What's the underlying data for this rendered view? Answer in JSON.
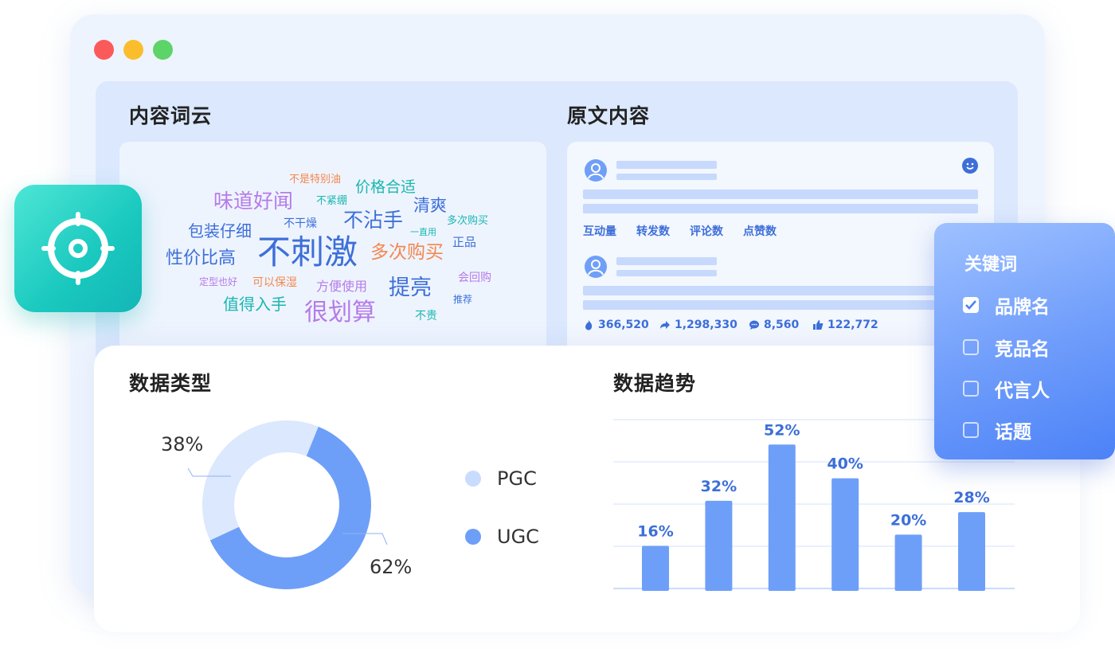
{
  "window": {
    "traffic_lights": [
      "red",
      "yellow",
      "green"
    ]
  },
  "wordcloud": {
    "title": "内容词云",
    "words": [
      {
        "text": "不是特别油",
        "color": "#f4874f"
      },
      {
        "text": "价格合适",
        "color": "#19b7b0"
      },
      {
        "text": "味道好闻",
        "color": "#b67be8"
      },
      {
        "text": "不紧绷",
        "color": "#19b7b0"
      },
      {
        "text": "清爽",
        "color": "#3d6fd8"
      },
      {
        "text": "不干燥",
        "color": "#3d6fd8"
      },
      {
        "text": "不沾手",
        "color": "#3d6fd8"
      },
      {
        "text": "多次购买",
        "color": "#19b7b0"
      },
      {
        "text": "包装仔细",
        "color": "#3d6fd8"
      },
      {
        "text": "一直用",
        "color": "#19b7b0"
      },
      {
        "text": "正品",
        "color": "#3d6fd8"
      },
      {
        "text": "性价比高",
        "color": "#3d6fd8"
      },
      {
        "text": "不刺激",
        "color": "#3d6fd8"
      },
      {
        "text": "多次购买",
        "color": "#f4874f"
      },
      {
        "text": "定型也好",
        "color": "#b67be8"
      },
      {
        "text": "可以保湿",
        "color": "#f4874f"
      },
      {
        "text": "方便使用",
        "color": "#b67be8"
      },
      {
        "text": "提亮",
        "color": "#3d6fd8"
      },
      {
        "text": "会回购",
        "color": "#b67be8"
      },
      {
        "text": "值得入手",
        "color": "#19b7b0"
      },
      {
        "text": "很划算",
        "color": "#b67be8"
      },
      {
        "text": "推荐",
        "color": "#3d6fd8"
      },
      {
        "text": "不贵",
        "color": "#19b7b0"
      }
    ]
  },
  "original": {
    "title": "原文内容",
    "metrics": [
      "互动量",
      "转发数",
      "评论数",
      "点赞数"
    ],
    "stats": [
      {
        "icon": "flame-icon",
        "value": "366,520"
      },
      {
        "icon": "share-icon",
        "value": "1,298,330"
      },
      {
        "icon": "comment-icon",
        "value": "8,560"
      },
      {
        "icon": "like-icon",
        "value": "122,772"
      }
    ]
  },
  "data_type": {
    "title": "数据类型",
    "legend": [
      {
        "label": "PGC",
        "color": "#c9dcfd"
      },
      {
        "label": "UGC",
        "color": "#6e9ff8"
      }
    ]
  },
  "data_trend": {
    "title": "数据趋势"
  },
  "keywords": {
    "title": "关键词",
    "items": [
      {
        "label": "品牌名",
        "checked": true
      },
      {
        "label": "竞品名",
        "checked": false
      },
      {
        "label": "代言人",
        "checked": false
      },
      {
        "label": "话题",
        "checked": false
      }
    ]
  },
  "chart_data": [
    {
      "type": "pie",
      "title": "数据类型",
      "categories": [
        "PGC",
        "UGC"
      ],
      "values": [
        38,
        62
      ],
      "labels": [
        "38%",
        "62%"
      ],
      "colors": [
        "#dbe8fd",
        "#6e9ff8"
      ],
      "legend": "right"
    },
    {
      "type": "bar",
      "title": "数据趋势",
      "values": [
        16,
        32,
        52,
        40,
        20,
        28
      ],
      "labels": [
        "16%",
        "32%",
        "52%",
        "40%",
        "20%",
        "28%"
      ],
      "ylim": [
        0,
        60
      ],
      "grid": true,
      "color": "#6e9ff8"
    }
  ]
}
